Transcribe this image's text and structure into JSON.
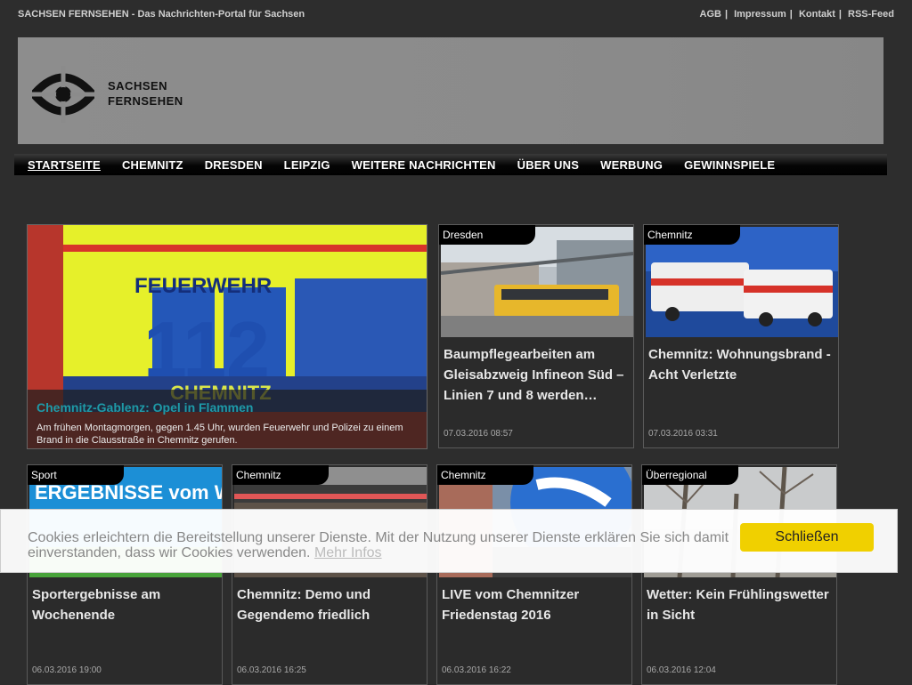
{
  "topbar": {
    "tagline": "SACHSEN FERNSEHEN - Das Nachrichten-Portal für Sachsen",
    "links": [
      "AGB",
      "Impressum",
      "Kontakt",
      "RSS-Feed"
    ]
  },
  "logo": {
    "line1": "SACHSEN",
    "line2": "FERNSEHEN"
  },
  "nav": [
    "STARTSEITE",
    "CHEMNITZ",
    "DRESDEN",
    "LEIPZIG",
    "WEITERE NACHRICHTEN",
    "ÜBER UNS",
    "WERBUNG",
    "GEWINNSPIELE"
  ],
  "hero": {
    "title": "Chemnitz-Gablenz: Opel in Flammen",
    "text": "Am frühen Montagmorgen, gegen 1.45 Uhr, wurden Feuerwehr und Polizei zu einem Brand in die Clausstraße in Chemnitz gerufen.",
    "image_text_1": "FEUERWEHR",
    "image_text_2": "112",
    "image_text_3": "CHEMNITZ"
  },
  "cards_top": [
    {
      "tag": "Dresden",
      "title": "Baumpflegearbeiten am Gleisabzweig Infineon Süd – Linien 7 und 8 werden…",
      "date": "07.03.2016 08:57"
    },
    {
      "tag": "Chemnitz",
      "title": "Chemnitz: Wohnungsbrand - Acht Verletzte",
      "date": "07.03.2016 03:31"
    }
  ],
  "cards_bottom": [
    {
      "tag": "Sport",
      "title": "Sportergebnisse am Wochenende",
      "date": "06.03.2016 19:00"
    },
    {
      "tag": "Chemnitz",
      "title": "Chemnitz: Demo und Gegendemo friedlich",
      "date": "06.03.2016 16:25"
    },
    {
      "tag": "Chemnitz",
      "title": "LIVE vom Chemnitzer Friedenstag 2016",
      "date": "06.03.2016 16:22"
    },
    {
      "tag": "Überregional",
      "title": "Wetter: Kein Frühlingswetter in Sicht",
      "date": "06.03.2016 12:04"
    }
  ],
  "sport_image_text": "ERGEBNISSE vom WOCHENENDE",
  "cookie": {
    "text": "Cookies erleichtern die Bereitstellung unserer Dienste. Mit der Nutzung unserer Dienste erklären Sie sich damit einverstanden, dass wir Cookies verwenden.",
    "more": "Mehr Infos",
    "button": "Schließen"
  },
  "colors": {
    "page_bg": "#2d2d2d",
    "accent_teal": "#1e9aa8",
    "cookie_button": "#f0d000"
  }
}
